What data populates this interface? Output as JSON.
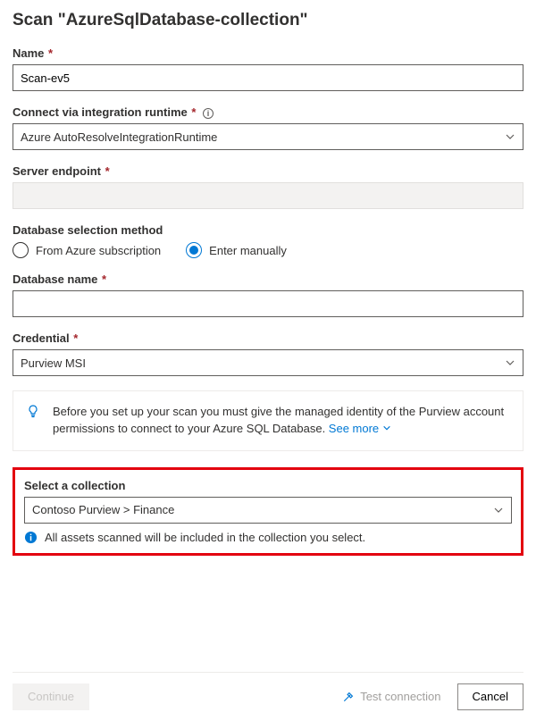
{
  "header": {
    "title": "Scan \"AzureSqlDatabase-collection\""
  },
  "name": {
    "label": "Name",
    "value": "Scan-ev5"
  },
  "runtime": {
    "label": "Connect via integration runtime",
    "value": "Azure AutoResolveIntegrationRuntime"
  },
  "endpoint": {
    "label": "Server endpoint",
    "value": ""
  },
  "dbmethod": {
    "label": "Database selection method",
    "opt1": "From Azure subscription",
    "opt2": "Enter manually",
    "selected": "opt2"
  },
  "dbname": {
    "label": "Database name",
    "value": ""
  },
  "credential": {
    "label": "Credential",
    "value": "Purview MSI"
  },
  "infobox": {
    "text": "Before you set up your scan you must give the managed identity of the Purview account permissions to connect to your Azure SQL Database. ",
    "link": "See more"
  },
  "collection": {
    "label": "Select a collection",
    "value": "Contoso Purview > Finance",
    "note": "All assets scanned will be included in the collection you select."
  },
  "footer": {
    "continue": "Continue",
    "test": "Test connection",
    "cancel": "Cancel"
  }
}
